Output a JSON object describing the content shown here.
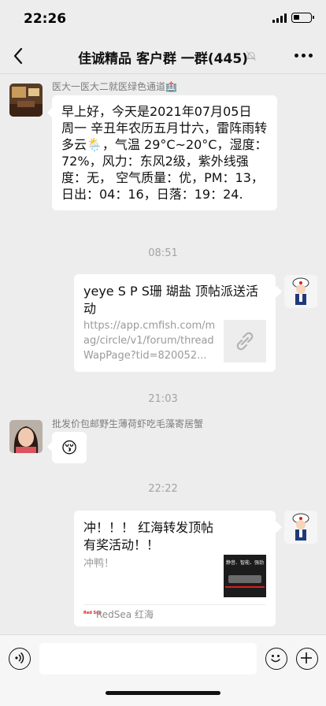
{
  "status_bar": {
    "time": "22:26",
    "battery_level_percent": 25
  },
  "nav": {
    "title": "佳诚精品 客户群 一群(445)"
  },
  "messages": {
    "m1": {
      "sender": "医大一医大二就医绿色通道🏥",
      "text": "早上好，今天是2021年07月05日 周一 辛丑年农历五月廿六，雷阵雨转多云🌦️，气温 29°C~20°C，湿度：72%，风力：东风2级，紫外线强度：无， 空气质量：优，PM：13， 日出：04：16，日落：19：24."
    },
    "t1": "08:51",
    "m2": {
      "title": "yeye S P S珊 瑚盐 顶帖派送活动",
      "desc": "https://app.cmfish.com/mag/circle/v1/forum/threadWapPage?tid=820052..."
    },
    "t2": "21:03",
    "m3": {
      "sender": "批发价包邮野生薄荷虾吃毛藻寄居蟹",
      "emoji": "😚"
    },
    "t3": "22:22",
    "m4": {
      "title": "冲！！！ 红海转发顶帖有奖活动！！",
      "desc": "冲鸭！",
      "thumb_text": "静音、智能、强劲",
      "source_logo": "Red Sea",
      "source": "RedSea 红海"
    }
  },
  "colors": {
    "background": "#ededed",
    "bubble": "#ffffff",
    "accent_red": "#d42222"
  },
  "icons": [
    "back-icon",
    "mute-icon",
    "more-icon",
    "voice-icon",
    "emoji-icon",
    "add-icon",
    "link-icon"
  ]
}
